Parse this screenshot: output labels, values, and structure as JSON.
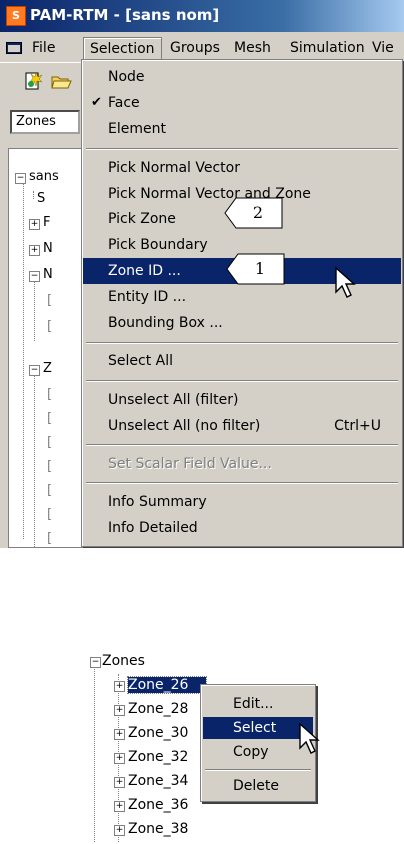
{
  "window": {
    "title": "PAM-RTM - [sans nom]",
    "logo_letter": "S"
  },
  "menubar": {
    "items": [
      "File",
      "Selection",
      "Groups",
      "Mesh",
      "Simulation",
      "Vie"
    ]
  },
  "toolbar": {
    "icons": [
      "new-icon",
      "open-folder-icon"
    ]
  },
  "combo": {
    "value": "Zones"
  },
  "tree": {
    "root_label": "sans",
    "children": [
      "S",
      "F",
      "N",
      "N"
    ],
    "zone_label": "Z"
  },
  "selection_menu": {
    "items": [
      {
        "label": "Node"
      },
      {
        "label": "Face",
        "checked": true,
        "check_glyph": "✔"
      },
      {
        "label": "Element"
      },
      {
        "label": "Pick Normal Vector"
      },
      {
        "label": "Pick Normal Vector and Zone"
      },
      {
        "label": "Pick Zone"
      },
      {
        "label": "Pick Boundary"
      },
      {
        "label": "Zone ID ...",
        "highlighted": true
      },
      {
        "label": "Entity ID ..."
      },
      {
        "label": "Bounding Box ..."
      },
      {
        "label": "Select All"
      },
      {
        "label": "Unselect All (filter)"
      },
      {
        "label": "Unselect All (no filter)",
        "shortcut": "Ctrl+U"
      },
      {
        "label": "Set Scalar Field Value...",
        "disabled": true
      },
      {
        "label": "Info Summary"
      },
      {
        "label": "Info Detailed"
      }
    ]
  },
  "callouts": [
    "2",
    "1"
  ],
  "zones_panel": {
    "root": "Zones",
    "items": [
      "Zone_26",
      "Zone_28",
      "Zone_30",
      "Zone_32",
      "Zone_34",
      "Zone_36",
      "Zone_38"
    ],
    "visible_labels": [
      "Zone_2&",
      "Zone_28",
      "Zone_30",
      "Zone_3:",
      "Zone_34",
      "Zone_36",
      "Zone_38"
    ]
  },
  "context_menu": {
    "items": [
      {
        "label": "Edit..."
      },
      {
        "label": "Select",
        "highlighted": true
      },
      {
        "label": "Copy"
      },
      {
        "label": "Delete"
      }
    ]
  },
  "colors": {
    "highlight": "#0a246a",
    "menu_bg": "#d4d0c8",
    "title_start": "#0a246a",
    "logo": "#ff7a20"
  }
}
